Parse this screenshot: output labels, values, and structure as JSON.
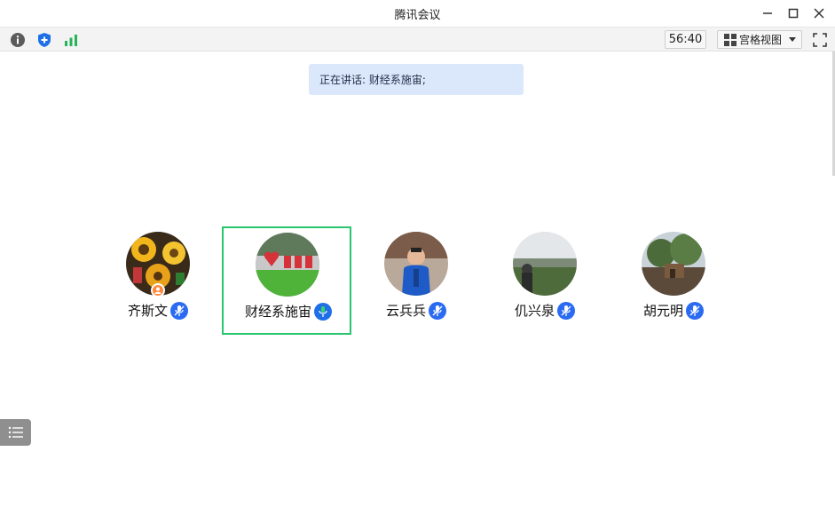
{
  "window": {
    "title": "腾讯会议"
  },
  "toolbar": {
    "info_icon": "info-icon",
    "security_icon": "shield-icon",
    "network_icon": "signal-bars-icon",
    "timer": "56:40",
    "view_label": "宫格视图",
    "fullscreen_icon": "fullscreen-icon"
  },
  "speaking": {
    "text": "正在讲话: 财经系施宙;"
  },
  "participants": [
    {
      "name": "齐斯文",
      "mic": "muted",
      "host": true,
      "active": false
    },
    {
      "name": "财经系施宙",
      "mic": "speaking",
      "host": false,
      "active": true
    },
    {
      "name": "云兵兵",
      "mic": "muted",
      "host": false,
      "active": false
    },
    {
      "name": "仉兴泉",
      "mic": "muted",
      "host": false,
      "active": false
    },
    {
      "name": "胡元明",
      "mic": "muted",
      "host": false,
      "active": false
    }
  ],
  "colors": {
    "accent": "#2a6bf2",
    "active_border": "#28c76f",
    "banner_bg": "#dbe8fb",
    "host_badge": "#ff8a3d"
  }
}
